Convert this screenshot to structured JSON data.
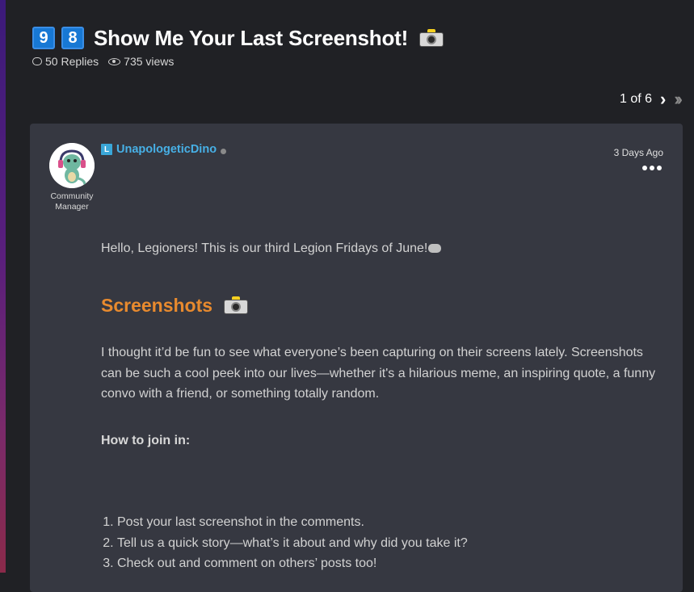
{
  "topic": {
    "number_badges": [
      "9",
      "8"
    ],
    "title": "Show Me Your Last Screenshot!",
    "replies": "50 Replies",
    "views": "735 views"
  },
  "pager": {
    "text": "1 of 6"
  },
  "post": {
    "author": "UnapologeticDino",
    "level_badge": "L",
    "role": "Community Manager",
    "timestamp": "3 Days Ago",
    "greeting": "Hello, Legioners! This is our third Legion Fridays of June!",
    "section_title": "Screenshots",
    "paragraph": "I thought it’d be fun to see what everyone’s been capturing on their screens lately. Screenshots can be such a cool peek into our lives—whether it's a hilarious meme, an inspiring quote, a funny convo with a friend, or something totally random.",
    "how_to_label": "How to join in:",
    "steps": [
      "Post your last screenshot in the comments.",
      "Tell us a quick story—what’s it about and why did you take it?",
      "Check out and comment on others’ posts too!"
    ]
  },
  "colors": {
    "background": "#202125",
    "card": "#363841",
    "author": "#47b0e6",
    "section_title": "#e88a2e",
    "badge": "#1778d4"
  },
  "icons": [
    "camera-icon",
    "comment-icon",
    "eye-icon",
    "chevron-right-icon",
    "double-chevron-right-icon",
    "more-options-icon",
    "gamepad-icon",
    "status-dot"
  ]
}
